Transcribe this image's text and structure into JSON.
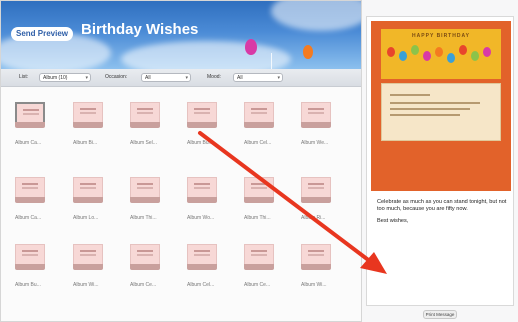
{
  "header": {
    "send_button_label": "Send Preview",
    "title": "Birthday Wishes"
  },
  "filters": {
    "list_label": "List:",
    "list_value": "Album (10)",
    "occasion_label": "Occasion:",
    "occasion_value": "All",
    "mood_label": "Mood:",
    "mood_value": "All"
  },
  "grid": {
    "rows": [
      [
        "Album Ca...",
        "Album Bi...",
        "Album Sel...",
        "Album Bu...",
        "Album Cel...",
        "Album We..."
      ],
      [
        "Album Ca...",
        "Album Lo...",
        "Album Thi...",
        "Album Wo...",
        "Album Thi...",
        "Album Ri..."
      ],
      [
        "Album Bu...",
        "Album Wi...",
        "Album Ce...",
        "Album Cel...",
        "Album Ce...",
        "Album Wi..."
      ]
    ],
    "selected": [
      0,
      0
    ]
  },
  "preview": {
    "card_heading": "HAPPY BIRTHDAY",
    "message_lines": [
      "Celebrate as much as you can stand tonight, but not too much, because you are fifty now.",
      "Best wishes,"
    ]
  },
  "print_button_label": "Print Message",
  "colors": {
    "arrow": "#e8361f",
    "card_orange": "#e2622a",
    "card_yellow": "#f1b728"
  }
}
